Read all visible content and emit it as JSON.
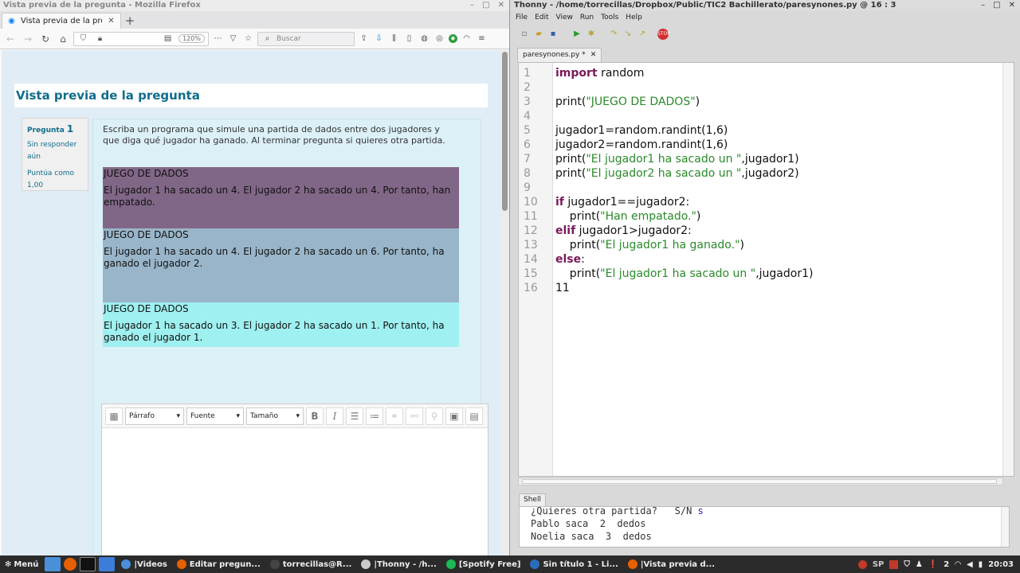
{
  "firefox": {
    "window_title": "Vista previa de la pregunta - Mozilla Firefox",
    "tab_title": "Vista previa de la pregunta",
    "zoom": "120%",
    "search_placeholder": "Buscar",
    "page": {
      "heading": "Vista previa de la pregunta",
      "info": {
        "question_label": "Pregunta",
        "question_number": "1",
        "status": "Sin responder aún",
        "grade": "Puntúa como 1,00"
      },
      "question_text": "Escriba un programa que simule una partida de dados entre dos jugadores y que diga qué jugador ha ganado. Al terminar pregunta si quieres otra partida.",
      "samples": [
        {
          "title": "JUEGO DE DADOS",
          "body": "El jugador 1 ha sacado un 4. El jugador 2 ha sacado un 4. Por tanto, han empatado.",
          "color": "#816787"
        },
        {
          "title": "JUEGO DE DADOS",
          "body": "El jugador 1 ha sacado un 4. El jugador 2 ha sacado un 6. Por tanto, ha ganado el jugador 2.",
          "color": "#99b5c9"
        },
        {
          "title": "JUEGO DE DADOS",
          "body": "El jugador 1 ha sacado un 3. El jugador 2 ha sacado un 1. Por tanto, ha ganado el jugador 1.",
          "color": "#9ff0f0"
        }
      ],
      "editor": {
        "format_select": "Párrafo",
        "font_select": "Fuente",
        "size_select": "Tamaño"
      }
    }
  },
  "thonny": {
    "window_title": "Thonny  -  /home/torrecillas/Dropbox/Public/TIC2 Bachillerato/paresynones.py  @  16 : 3",
    "menu": [
      "File",
      "Edit",
      "View",
      "Run",
      "Tools",
      "Help"
    ],
    "tab_name": "paresynones.py *",
    "line_numbers": [
      "1",
      "2",
      "3",
      "4",
      "5",
      "6",
      "7",
      "8",
      "9",
      "10",
      "11",
      "12",
      "13",
      "14",
      "15",
      "16"
    ],
    "code_lines": [
      "<span class='kw'>import</span> random",
      "",
      "print(<span class='str'>\"JUEGO DE DADOS\"</span>)",
      "",
      "jugador1=random.randint(1,6)",
      "jugador2=random.randint(1,6)",
      "print(<span class='str'>\"El jugador1 ha sacado un \"</span>,jugador1)",
      "print(<span class='str'>\"El jugador2 ha sacado un \"</span>,jugador2)",
      "",
      "<span class='kw'>if</span> jugador1==jugador2:",
      "    print(<span class='str'>\"Han empatado.\"</span>)",
      "<span class='kw'>elif</span> jugador1>jugador2:",
      "    print(<span class='str'>\"El jugador1 ha ganado.\"</span>)",
      "<span class='kw'>else</span>:",
      "    print(<span class='str'>\"El jugador1 ha sacado un \"</span>,jugador1)",
      "11"
    ],
    "shell_tab": "Shell",
    "shell_lines": [
      {
        "text": "¿Quieres otra partida?   S/N ",
        "input": "s"
      },
      {
        "text": "Pablo saca  2  dedos",
        "input": ""
      },
      {
        "text": "Noelia saca  3  dedos",
        "input": ""
      }
    ]
  },
  "taskbar": {
    "menu_label": "Menú",
    "tasks": [
      {
        "label": "|Videos",
        "icon": "folder-icon",
        "color": "#4a90d9"
      },
      {
        "label": "Editar pregun...",
        "icon": "firefox-icon",
        "color": "#e66000"
      },
      {
        "label": "torrecillas@R...",
        "icon": "terminal-icon",
        "color": "#444444"
      },
      {
        "label": "|Thonny  -  /h...",
        "icon": "thonny-icon",
        "color": "#cccccc"
      },
      {
        "label": "[Spotify Free]",
        "icon": "spotify-icon",
        "color": "#1db954"
      },
      {
        "label": "Sin título 1 - Li...",
        "icon": "writer-icon",
        "color": "#2a6ebb"
      },
      {
        "label": "|Vista previa d...",
        "icon": "firefox-icon",
        "color": "#e66000"
      }
    ],
    "tray": {
      "keyboard_layout": "SP",
      "notifications": "2",
      "clock": "20:03"
    }
  }
}
